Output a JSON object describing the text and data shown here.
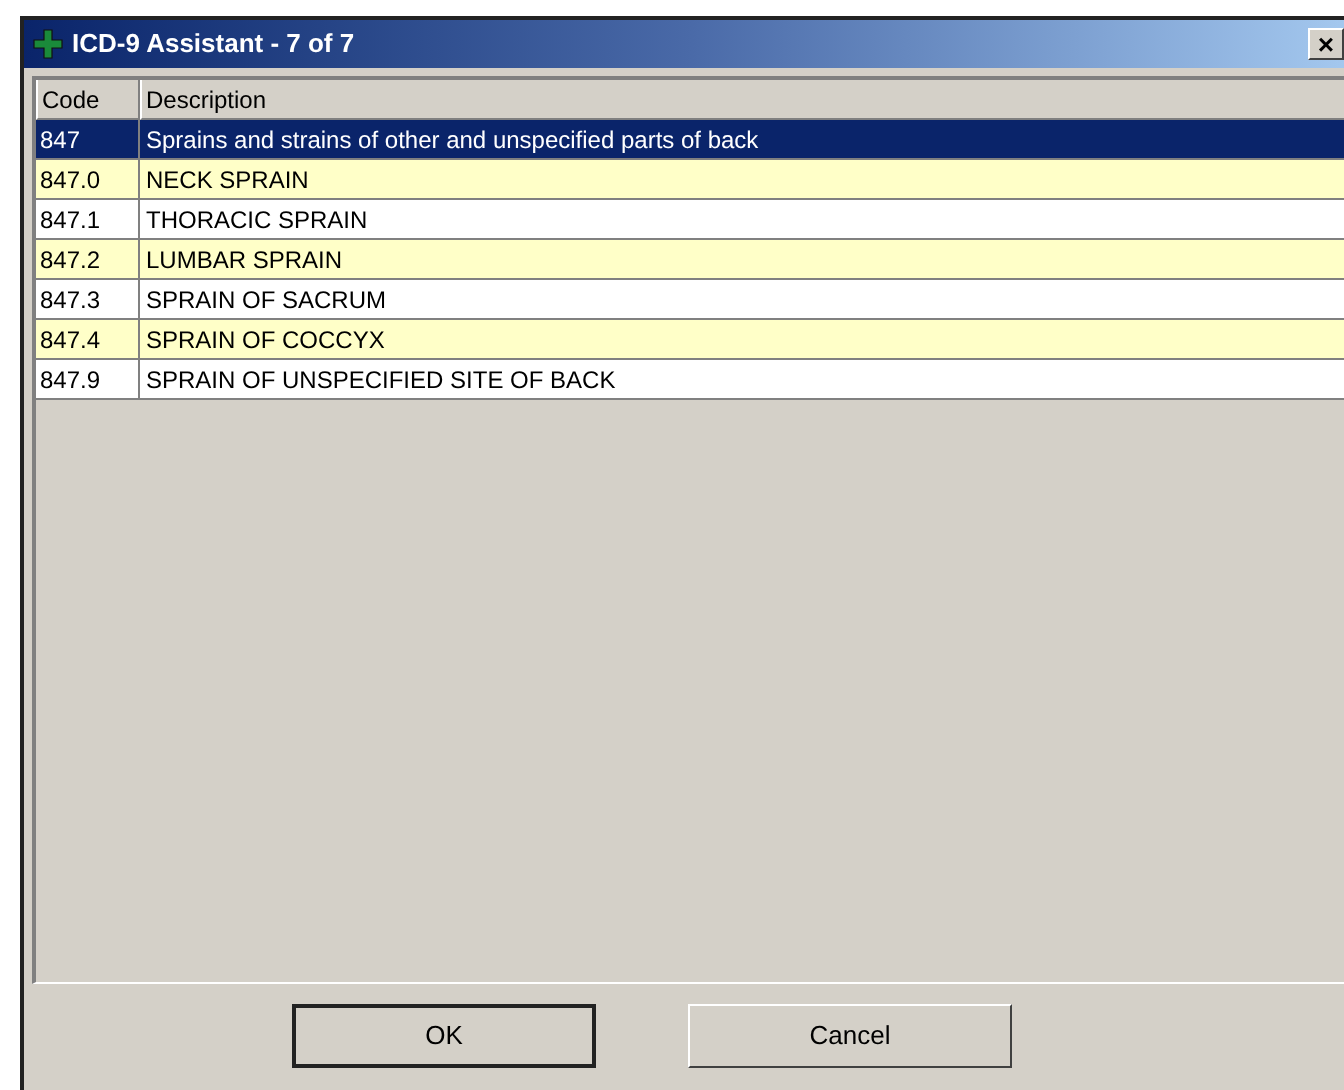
{
  "window": {
    "title": "ICD-9 Assistant - 7 of 7",
    "close": "×"
  },
  "table": {
    "columns": [
      "Code",
      "Description"
    ],
    "rows": [
      {
        "code": "847",
        "description": "Sprains and strains of other and unspecified parts of back",
        "selected": true
      },
      {
        "code": "847.0",
        "description": "NECK SPRAIN",
        "selected": false
      },
      {
        "code": "847.1",
        "description": "THORACIC SPRAIN",
        "selected": false
      },
      {
        "code": "847.2",
        "description": "LUMBAR SPRAIN",
        "selected": false
      },
      {
        "code": "847.3",
        "description": "SPRAIN OF SACRUM",
        "selected": false
      },
      {
        "code": "847.4",
        "description": "SPRAIN OF COCCYX",
        "selected": false
      },
      {
        "code": "847.9",
        "description": "SPRAIN OF UNSPECIFIED SITE OF BACK",
        "selected": false
      }
    ]
  },
  "buttons": [
    {
      "label": "OK",
      "default": true
    },
    {
      "label": "Cancel",
      "default": false
    }
  ]
}
